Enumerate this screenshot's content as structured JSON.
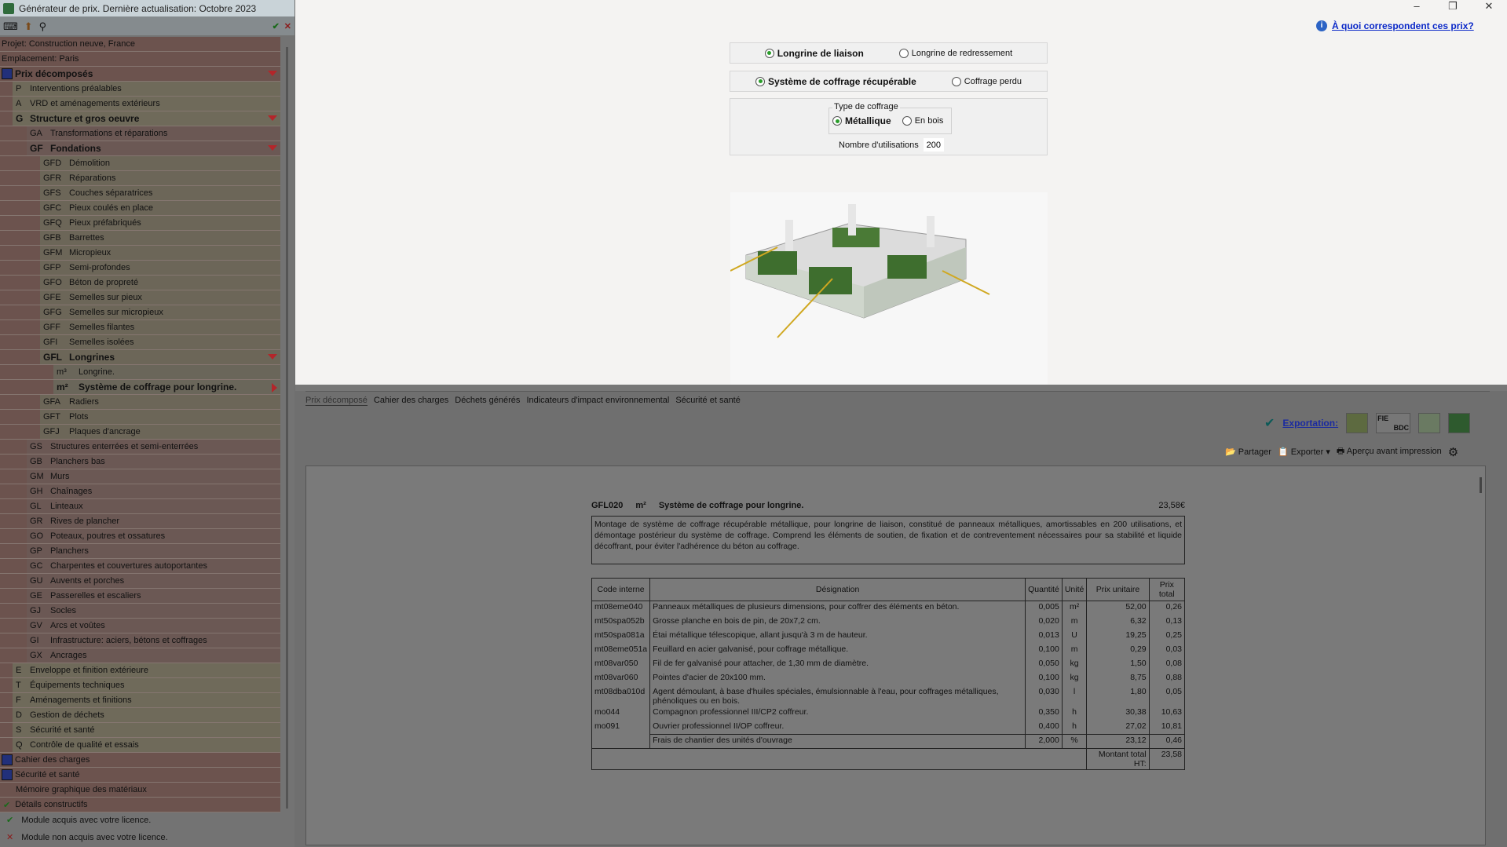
{
  "window": {
    "title": "Générateur de prix. Dernière actualisation: Octobre 2023",
    "controls": [
      "–",
      "❐",
      "✕"
    ]
  },
  "toolbar": {
    "ok": "✔",
    "cancel": "✕"
  },
  "tree": [
    {
      "code": "",
      "label": "Projet: Construction neuve, France",
      "lvl": 0,
      "plain": true
    },
    {
      "code": "",
      "label": "Emplacement: Paris",
      "lvl": 0,
      "plain": true
    },
    {
      "code": "",
      "label": "Prix décomposés",
      "lvl": 0,
      "bold": true,
      "arrow": "down",
      "icon": "euro-icon"
    },
    {
      "code": "P",
      "label": "Interventions préalables",
      "lvl": 1
    },
    {
      "code": "A",
      "label": "VRD et aménagements extérieurs",
      "lvl": 1
    },
    {
      "code": "G",
      "label": "Structure et gros oeuvre",
      "lvl": 1,
      "bold": true,
      "arrow": "down"
    },
    {
      "code": "GA",
      "label": "Transformations et réparations",
      "lvl": 2
    },
    {
      "code": "GF",
      "label": "Fondations",
      "lvl": 2,
      "bold": true,
      "arrow": "down"
    },
    {
      "code": "GFD",
      "label": "Démolition",
      "lvl": 3
    },
    {
      "code": "GFR",
      "label": "Réparations",
      "lvl": 3
    },
    {
      "code": "GFS",
      "label": "Couches séparatrices",
      "lvl": 3
    },
    {
      "code": "GFC",
      "label": "Pieux coulés en place",
      "lvl": 3
    },
    {
      "code": "GFQ",
      "label": "Pieux préfabriqués",
      "lvl": 3
    },
    {
      "code": "GFB",
      "label": "Barrettes",
      "lvl": 3
    },
    {
      "code": "GFM",
      "label": "Micropieux",
      "lvl": 3
    },
    {
      "code": "GFP",
      "label": "Semi-profondes",
      "lvl": 3
    },
    {
      "code": "GFO",
      "label": "Béton de propreté",
      "lvl": 3
    },
    {
      "code": "GFE",
      "label": "Semelles sur pieux",
      "lvl": 3
    },
    {
      "code": "GFG",
      "label": "Semelles sur micropieux",
      "lvl": 3
    },
    {
      "code": "GFF",
      "label": "Semelles filantes",
      "lvl": 3
    },
    {
      "code": "GFI",
      "label": "Semelles isolées",
      "lvl": 3
    },
    {
      "code": "GFL",
      "label": "Longrines",
      "lvl": 3,
      "bold": true,
      "arrow": "down"
    },
    {
      "code": "m³",
      "label": "Longrine.",
      "lvl": 4
    },
    {
      "code": "m²",
      "label": "Système de coffrage pour longrine.",
      "lvl": 4,
      "bold": true,
      "arrow": "right"
    },
    {
      "code": "GFA",
      "label": "Radiers",
      "lvl": 3
    },
    {
      "code": "GFT",
      "label": "Plots",
      "lvl": 3
    },
    {
      "code": "GFJ",
      "label": "Plaques d'ancrage",
      "lvl": 3
    },
    {
      "code": "GS",
      "label": "Structures enterrées et semi-enterrées",
      "lvl": 2
    },
    {
      "code": "GB",
      "label": "Planchers bas",
      "lvl": 2
    },
    {
      "code": "GM",
      "label": "Murs",
      "lvl": 2
    },
    {
      "code": "GH",
      "label": "Chaînages",
      "lvl": 2
    },
    {
      "code": "GL",
      "label": "Linteaux",
      "lvl": 2
    },
    {
      "code": "GR",
      "label": "Rives de plancher",
      "lvl": 2
    },
    {
      "code": "GO",
      "label": "Poteaux, poutres et ossatures",
      "lvl": 2
    },
    {
      "code": "GP",
      "label": "Planchers",
      "lvl": 2
    },
    {
      "code": "GC",
      "label": "Charpentes et couvertures autoportantes",
      "lvl": 2
    },
    {
      "code": "GU",
      "label": "Auvents et porches",
      "lvl": 2
    },
    {
      "code": "GE",
      "label": "Passerelles et escaliers",
      "lvl": 2
    },
    {
      "code": "GJ",
      "label": "Socles",
      "lvl": 2
    },
    {
      "code": "GV",
      "label": "Arcs et voûtes",
      "lvl": 2
    },
    {
      "code": "GI",
      "label": "Infrastructure: aciers, bétons et coffrages",
      "lvl": 2
    },
    {
      "code": "GX",
      "label": "Ancrages",
      "lvl": 2
    },
    {
      "code": "E",
      "label": "Enveloppe et finition extérieure",
      "lvl": 1
    },
    {
      "code": "T",
      "label": "Équipements techniques",
      "lvl": 1
    },
    {
      "code": "F",
      "label": "Aménagements et finitions",
      "lvl": 1
    },
    {
      "code": "D",
      "label": "Gestion de déchets",
      "lvl": 1
    },
    {
      "code": "S",
      "label": "Sécurité et santé",
      "lvl": 1
    },
    {
      "code": "Q",
      "label": "Contrôle de qualité et essais",
      "lvl": 1
    },
    {
      "code": "",
      "label": "Cahier des charges",
      "lvl": 0,
      "icon": "scroll-icon"
    },
    {
      "code": "",
      "label": "Sécurité et santé",
      "lvl": 0,
      "icon": "helmet-icon"
    },
    {
      "code": "",
      "label": "Mémoire graphique des matériaux",
      "lvl": 0,
      "indent": true
    },
    {
      "code": "",
      "label": "Détails constructifs",
      "lvl": 0,
      "check": true
    }
  ],
  "legend": {
    "acquired": "Module acquis avec votre licence.",
    "not_acquired": "Module non acquis avec votre licence."
  },
  "help_link": "À quoi correspondent ces prix?",
  "options": {
    "type1": {
      "a": "Longrine de liaison",
      "b": "Longrine de redressement"
    },
    "type2": {
      "a": "Système de coffrage récupérable",
      "b": "Coffrage perdu"
    },
    "coffrage": {
      "legend": "Type de coffrage",
      "a": "Métallique",
      "b": "En bois"
    },
    "uses": {
      "label": "Nombre d'utilisations",
      "value": "200"
    }
  },
  "tabs": [
    "Prix décomposé",
    "Cahier des charges",
    "Déchets générés",
    "Indicateurs d'impact environnemental",
    "Sécurité et santé"
  ],
  "export": {
    "label": "Exportation:",
    "fie": "FIE",
    "bdc": "BDC",
    "share": "Partager",
    "export": "Exporter",
    "preview": "Aperçu avant impression"
  },
  "item": {
    "code": "GFL020",
    "unit": "m²",
    "title": "Système de coffrage pour longrine.",
    "price": "23,58€",
    "description": "Montage de système de coffrage récupérable métallique, pour longrine de liaison, constitué de panneaux métalliques, amortissables en 200 utilisations, et démontage postérieur du système de coffrage. Comprend les éléments de soutien, de fixation et de contreventement nécessaires pour sa stabilité et liquide décoffrant, pour éviter l'adhérence du béton au coffrage."
  },
  "table": {
    "headers": [
      "Code interne",
      "Désignation",
      "Quantité",
      "Unité",
      "Prix unitaire",
      "Prix total"
    ],
    "rows": [
      [
        "mt08eme040",
        "Panneaux métalliques de plusieurs dimensions, pour coffrer des éléments en béton.",
        "0,005",
        "m²",
        "52,00",
        "0,26"
      ],
      [
        "mt50spa052b",
        "Grosse planche en bois de pin, de 20x7,2 cm.",
        "0,020",
        "m",
        "6,32",
        "0,13"
      ],
      [
        "mt50spa081a",
        "Étai métallique télescopique, allant jusqu'à 3 m de hauteur.",
        "0,013",
        "U",
        "19,25",
        "0,25"
      ],
      [
        "mt08eme051a",
        "Feuillard en acier galvanisé, pour coffrage métallique.",
        "0,100",
        "m",
        "0,29",
        "0,03"
      ],
      [
        "mt08var050",
        "Fil de fer galvanisé pour attacher, de 1,30 mm de diamètre.",
        "0,050",
        "kg",
        "1,50",
        "0,08"
      ],
      [
        "mt08var060",
        "Pointes d'acier de 20x100 mm.",
        "0,100",
        "kg",
        "8,75",
        "0,88"
      ],
      [
        "mt08dba010d",
        "Agent démoulant, à base d'huiles spéciales, émulsionnable à l'eau, pour coffrages métalliques, phénoliques ou en bois.",
        "0,030",
        "l",
        "1,80",
        "0,05"
      ],
      [
        "mo044",
        "Compagnon professionnel III/CP2 coffreur.",
        "0,350",
        "h",
        "30,38",
        "10,63"
      ],
      [
        "mo091",
        "Ouvrier professionnel II/OP coffreur.",
        "0,400",
        "h",
        "27,02",
        "10,81"
      ]
    ],
    "fees": [
      "",
      "Frais de chantier des unités d'ouvrage",
      "2,000",
      "%",
      "23,12",
      "0,46"
    ],
    "total_label": "Montant total HT:",
    "total": "23,58"
  }
}
